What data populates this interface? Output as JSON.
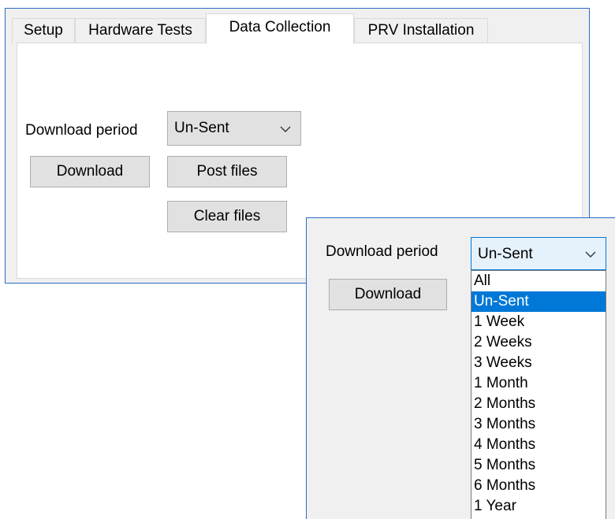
{
  "tabs": [
    {
      "label": "Setup"
    },
    {
      "label": "Hardware Tests"
    },
    {
      "label": "Data Collection"
    },
    {
      "label": "PRV Installation"
    }
  ],
  "active_tab": "Data Collection",
  "main": {
    "download_period_label": "Download period",
    "download_period_value": "Un-Sent",
    "download_button": "Download",
    "post_files_button": "Post files",
    "clear_files_button": "Clear files"
  },
  "zoom": {
    "download_period_label": "Download period",
    "download_period_value": "Un-Sent",
    "download_button": "Download",
    "dropdown_options": [
      "All",
      "Un-Sent",
      "1 Week",
      "2 Weeks",
      "3 Weeks",
      "1 Month",
      "2 Months",
      "3 Months",
      "4 Months",
      "5 Months",
      "6 Months",
      "1 Year"
    ],
    "selected_option": "Un-Sent"
  },
  "icons": {
    "combo_arrow": "chevron-down-icon"
  },
  "colors": {
    "accent": "#0078d7",
    "frame": "#2b6cc4",
    "panel_bg": "#f0f0f0",
    "button_bg": "#e1e1e1"
  }
}
